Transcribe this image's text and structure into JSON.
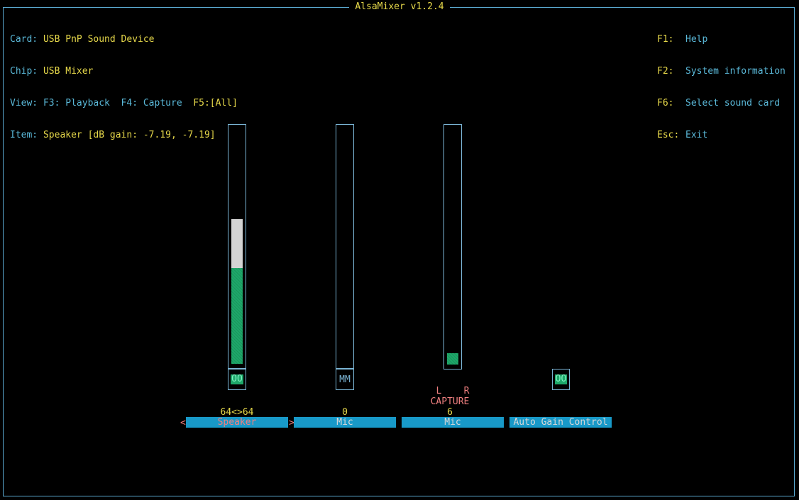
{
  "title": "AlsaMixer v1.2.4",
  "info": {
    "card_label": "Card:",
    "card_value": "USB PnP Sound Device",
    "chip_label": "Chip:",
    "chip_value": "USB Mixer",
    "view_label": "View:",
    "view_f3": "F3: Playback",
    "view_f4": "F4: Capture",
    "view_f5": "F5:[All]",
    "item_label": "Item:",
    "item_value": "Speaker [dB gain: -7.19, -7.19]"
  },
  "help": [
    {
      "key": "F1:",
      "text": "Help"
    },
    {
      "key": "F2:",
      "text": "System information"
    },
    {
      "key": "F6:",
      "text": "Select sound card"
    },
    {
      "key": "Esc:",
      "text": "Exit"
    }
  ],
  "controls": [
    {
      "name": "Speaker",
      "value_text": "64<>64",
      "switch": "OO",
      "level": 0.61,
      "selected": true
    },
    {
      "name": "Mic",
      "value_text": "0",
      "switch": "MM",
      "level": 0
    },
    {
      "name": "Mic",
      "value_text": "6",
      "capture_lr": "L    R",
      "capture_label": "CAPTURE",
      "level": 0.05
    },
    {
      "name": "Auto Gain Control",
      "switch": "OO"
    }
  ],
  "selection_arrows": {
    "left": "<",
    "right": ">"
  },
  "colors": {
    "background": "#000000",
    "border": "#5aa9d0",
    "label": "#5ab8d8",
    "value": "#e6d84a",
    "level_green": "#1ea86a",
    "name_bar": "#1899c8",
    "selected_text": "#f08080"
  }
}
